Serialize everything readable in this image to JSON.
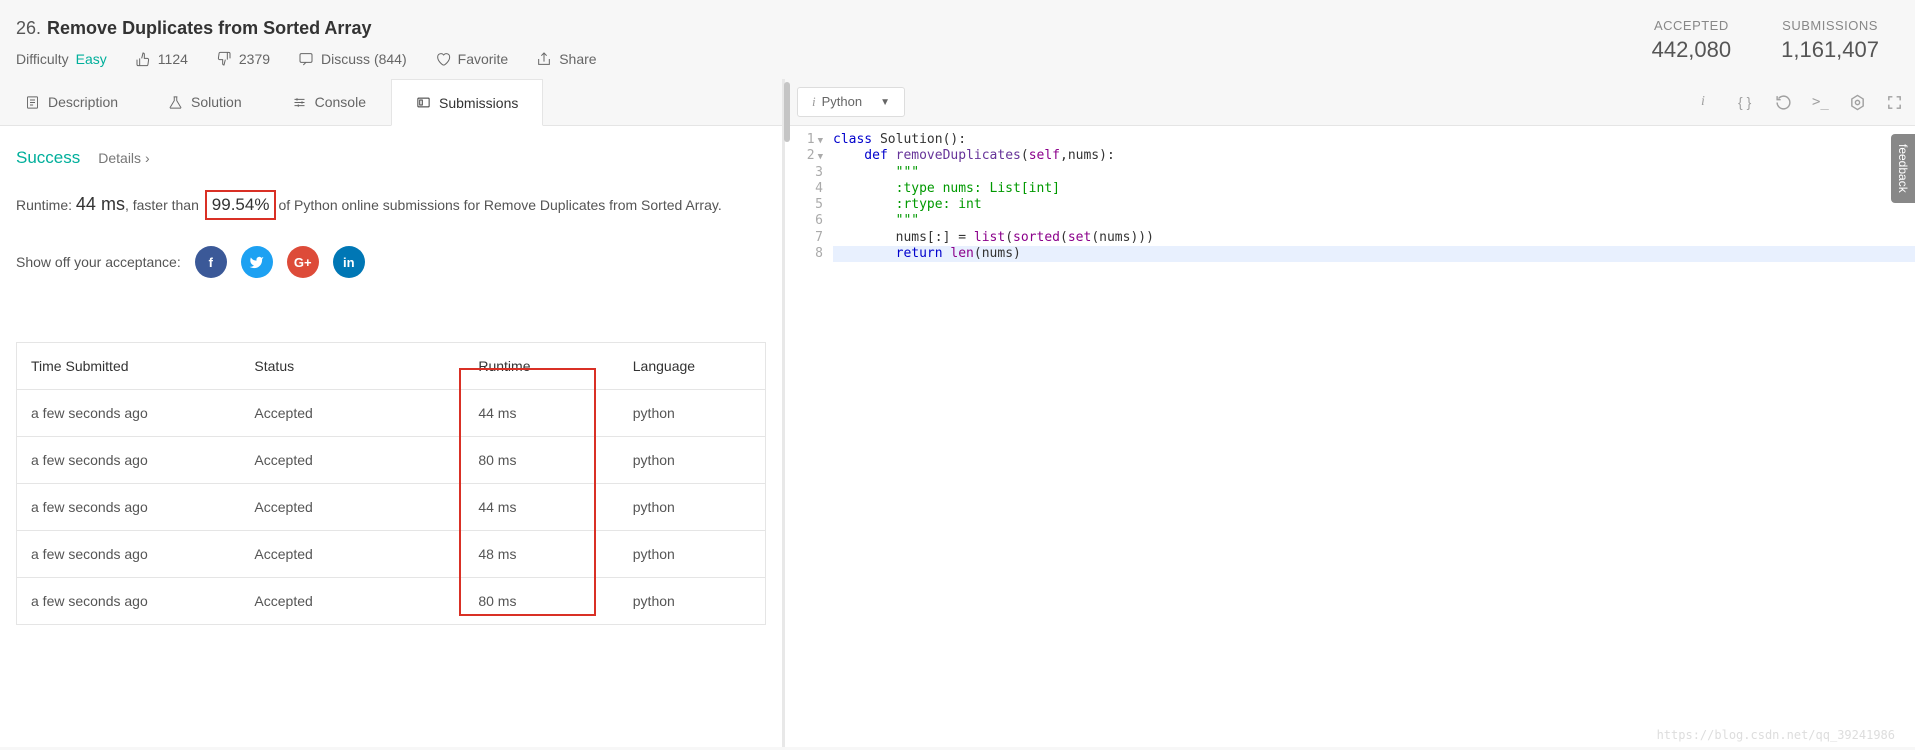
{
  "problem": {
    "number": "26.",
    "title": "Remove Duplicates from Sorted Array",
    "difficulty_label": "Difficulty",
    "difficulty": "Easy",
    "likes": "1124",
    "dislikes": "2379",
    "discuss": "Discuss (844)",
    "favorite": "Favorite",
    "share": "Share"
  },
  "stats": {
    "accepted_label": "ACCEPTED",
    "accepted": "442,080",
    "submissions_label": "SUBMISSIONS",
    "submissions": "1,161,407"
  },
  "tabs": {
    "description": "Description",
    "solution": "Solution",
    "console": "Console",
    "submissions": "Submissions"
  },
  "result": {
    "status": "Success",
    "details": "Details",
    "runtime_prefix": "Runtime: ",
    "runtime": "44 ms",
    "faster_prefix": ", faster than",
    "percent": "99.54%",
    "faster_suffix": "of Python online submissions for Remove Duplicates from Sorted Array.",
    "share_label": "Show off your acceptance:"
  },
  "social": {
    "fb": "f",
    "tw": "",
    "gp": "G+",
    "li": "in"
  },
  "sub_headers": {
    "time": "Time Submitted",
    "status": "Status",
    "runtime": "Runtime",
    "lang": "Language"
  },
  "subs": [
    {
      "time": "a few seconds ago",
      "status": "Accepted",
      "runtime": "44 ms",
      "lang": "python"
    },
    {
      "time": "a few seconds ago",
      "status": "Accepted",
      "runtime": "80 ms",
      "lang": "python"
    },
    {
      "time": "a few seconds ago",
      "status": "Accepted",
      "runtime": "44 ms",
      "lang": "python"
    },
    {
      "time": "a few seconds ago",
      "status": "Accepted",
      "runtime": "48 ms",
      "lang": "python"
    },
    {
      "time": "a few seconds ago",
      "status": "Accepted",
      "runtime": "80 ms",
      "lang": "python"
    }
  ],
  "editor": {
    "language": "Python",
    "lines": [
      "1",
      "2",
      "3",
      "4",
      "5",
      "6",
      "7",
      "8"
    ]
  },
  "code": {
    "l1a": "class",
    "l1b": " Solution():",
    "l2a": "    def",
    "l2b": " removeDuplicates",
    "l2c": "(",
    "l2d": "self",
    "l2e": ",nums):",
    "l3": "        \"\"\"",
    "l4": "        :type nums: List[int]",
    "l5": "        :rtype: int",
    "l6": "        \"\"\"",
    "l7a": "        nums[:] = ",
    "l7b": "list",
    "l7c": "(",
    "l7d": "sorted",
    "l7e": "(",
    "l7f": "set",
    "l7g": "(nums)))",
    "l8a": "        return",
    "l8b": " len",
    "l8c": "(nums)"
  },
  "feedback": "feedback",
  "watermark": "https://blog.csdn.net/qq_39241986"
}
